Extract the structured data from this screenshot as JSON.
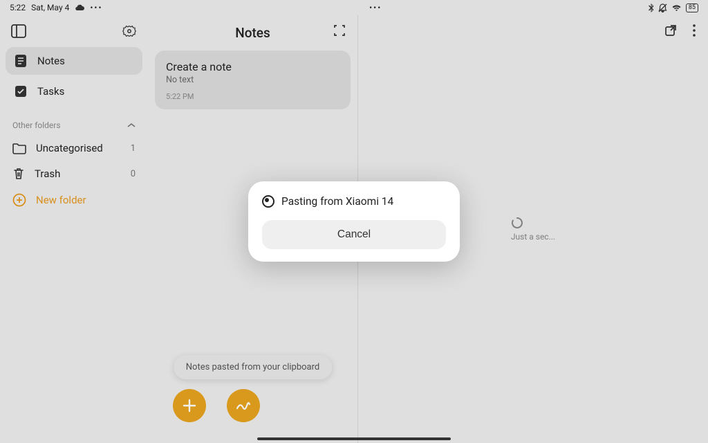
{
  "statusbar": {
    "time": "5:22",
    "date": "Sat, May 4",
    "battery": "85"
  },
  "sidebar": {
    "nav": {
      "notes": "Notes",
      "tasks": "Tasks"
    },
    "section_label": "Other folders",
    "folders": {
      "uncategorised": {
        "label": "Uncategorised",
        "count": "1"
      },
      "trash": {
        "label": "Trash",
        "count": "0"
      }
    },
    "new_folder": "New folder"
  },
  "middle": {
    "title": "Notes",
    "card": {
      "title": "Create a note",
      "subtitle": "No text",
      "time": "5:22 PM"
    },
    "toast": "Notes pasted from your clipboard"
  },
  "detail": {
    "loading": "Just a sec..."
  },
  "dialog": {
    "message": "Pasting from Xiaomi 14",
    "cancel": "Cancel"
  }
}
